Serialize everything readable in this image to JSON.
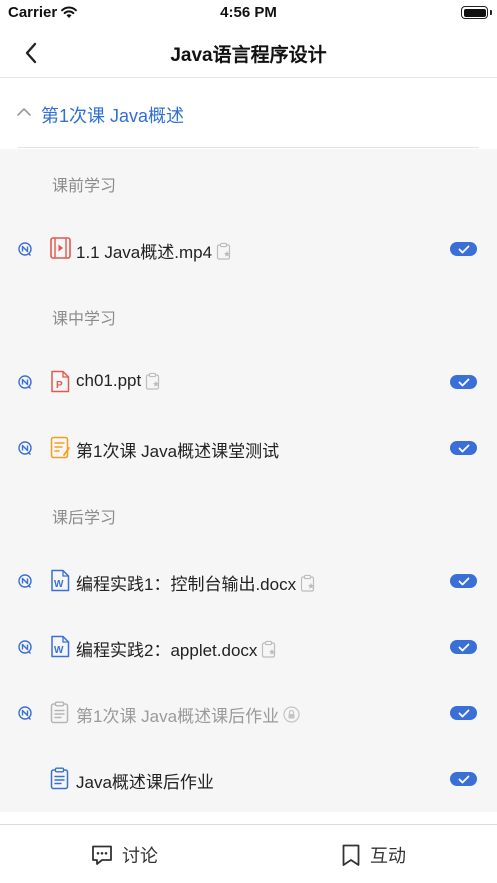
{
  "status_bar": {
    "carrier": "Carrier",
    "time": "4:56 PM"
  },
  "nav": {
    "title": "Java语言程序设计"
  },
  "chapter": {
    "title": "第1次课  Java概述"
  },
  "sections": {
    "before": "课前学习",
    "during": "课中学习",
    "after": "课后学习"
  },
  "items": [
    {
      "name": "1.1 Java概述.mp4",
      "file_icon": "video-file-icon",
      "tail_icon": "clipboard-star-icon",
      "status_icon": "live-status-icon",
      "checked": true
    },
    {
      "name": "ch01.ppt",
      "file_icon": "ppt-file-icon",
      "tail_icon": "clipboard-star-icon",
      "status_icon": "live-status-icon",
      "checked": true
    },
    {
      "name": "第1次课 Java概述课堂测试",
      "file_icon": "quiz-file-icon",
      "status_icon": "live-status-icon",
      "checked": true
    },
    {
      "name": "编程实践1：控制台输出.docx",
      "file_icon": "word-file-icon",
      "tail_icon": "clipboard-star-icon",
      "status_icon": "live-status-icon",
      "checked": true
    },
    {
      "name": "编程实践2：applet.docx",
      "file_icon": "word-file-icon",
      "tail_icon": "clipboard-star-icon",
      "status_icon": "live-status-icon",
      "checked": true
    },
    {
      "name": "第1次课 Java概述课后作业",
      "file_icon": "homework-file-icon",
      "tail_icon": "lock-icon",
      "status_icon": "live-status-icon",
      "checked": true,
      "dimmed": true
    },
    {
      "name": "Java概述课后作业",
      "file_icon": "homework-file-icon",
      "checked": true
    }
  ],
  "tabs": {
    "discuss": "讨论",
    "interact": "互动"
  },
  "colors": {
    "accent": "#3a6fd8",
    "chapter_text": "#2f6fd6",
    "list_bg": "#f6f6f6"
  }
}
